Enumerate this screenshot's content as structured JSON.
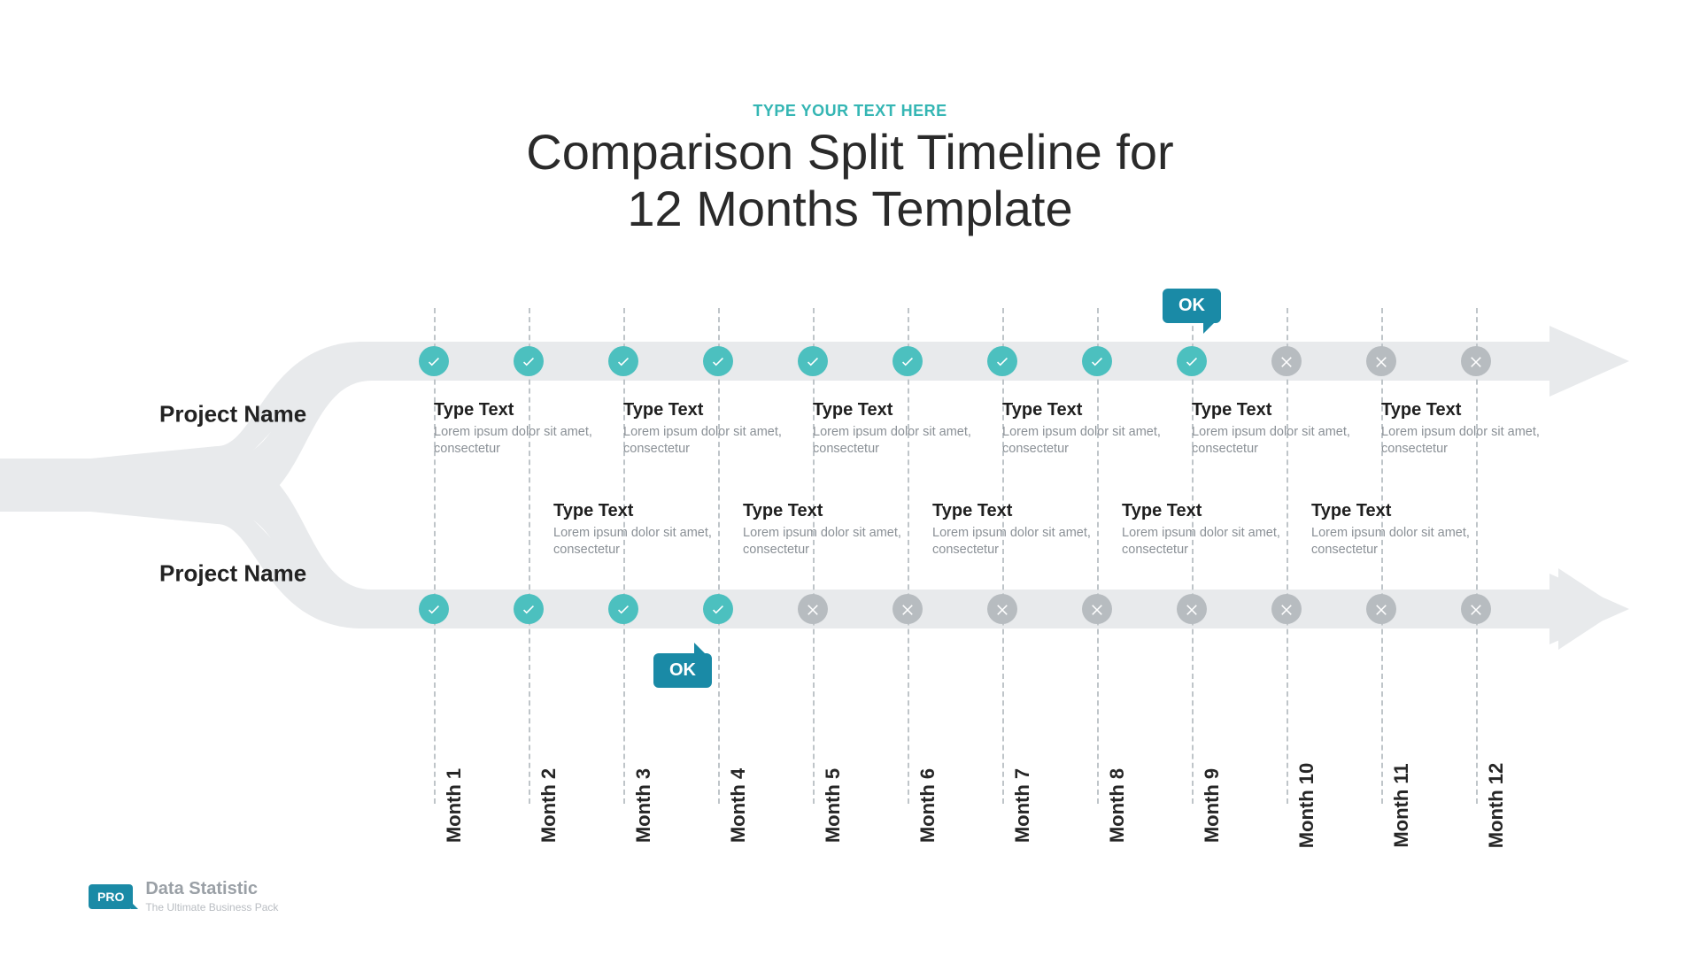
{
  "header": {
    "eyebrow": "TYPE YOUR TEXT HERE",
    "title_line1": "Comparison Split Timeline for",
    "title_line2": "12 Months Template"
  },
  "brand": {
    "badge": "PRO",
    "name": "Data Statistic",
    "tag": "The Ultimate Business Pack"
  },
  "bubble_label": "OK",
  "project_top": {
    "name": "Project Name"
  },
  "project_bottom": {
    "name": "Project Name"
  },
  "months": [
    "Month 1",
    "Month 2",
    "Month 3",
    "Month 4",
    "Month 5",
    "Month 6",
    "Month 7",
    "Month 8",
    "Month 9",
    "Month 10",
    "Month 11",
    "Month 12"
  ],
  "top_status": [
    "ok",
    "ok",
    "ok",
    "ok",
    "ok",
    "ok",
    "ok",
    "ok",
    "ok",
    "x",
    "x",
    "x"
  ],
  "bottom_status": [
    "ok",
    "ok",
    "ok",
    "ok",
    "x",
    "x",
    "x",
    "x",
    "x",
    "x",
    "x",
    "x"
  ],
  "bubble_top_index": 8,
  "bubble_bottom_index": 3,
  "top_blocks": [
    {
      "title": "Type Text",
      "body": "Lorem ipsum dolor sit amet, consectetur"
    },
    {
      "title": "Type Text",
      "body": "Lorem ipsum dolor sit amet, consectetur"
    },
    {
      "title": "Type Text",
      "body": "Lorem ipsum dolor sit amet, consectetur"
    },
    {
      "title": "Type Text",
      "body": "Lorem ipsum dolor sit amet, consectetur"
    },
    {
      "title": "Type Text",
      "body": "Lorem ipsum dolor sit amet, consectetur"
    },
    {
      "title": "Type Text",
      "body": "Lorem ipsum dolor sit amet, consectetur"
    }
  ],
  "bottom_blocks": [
    {
      "title": "Type Text",
      "body": "Lorem ipsum dolor sit amet, consectetur"
    },
    {
      "title": "Type Text",
      "body": "Lorem ipsum dolor sit amet, consectetur"
    },
    {
      "title": "Type Text",
      "body": "Lorem ipsum dolor sit amet, consectetur"
    },
    {
      "title": "Type Text",
      "body": "Lorem ipsum dolor sit amet, consectetur"
    },
    {
      "title": "Type Text",
      "body": "Lorem ipsum dolor sit amet, consectetur"
    }
  ],
  "chart_data": {
    "type": "table",
    "title": "Comparison Split Timeline for 12 Months Template",
    "categories": [
      "Month 1",
      "Month 2",
      "Month 3",
      "Month 4",
      "Month 5",
      "Month 6",
      "Month 7",
      "Month 8",
      "Month 9",
      "Month 10",
      "Month 11",
      "Month 12"
    ],
    "series": [
      {
        "name": "Project Name (top)",
        "values": [
          1,
          1,
          1,
          1,
          1,
          1,
          1,
          1,
          1,
          0,
          0,
          0
        ]
      },
      {
        "name": "Project Name (bottom)",
        "values": [
          1,
          1,
          1,
          1,
          0,
          0,
          0,
          0,
          0,
          0,
          0,
          0
        ]
      }
    ],
    "legend": {
      "1": "check / complete",
      "0": "x / not complete"
    },
    "callouts": [
      {
        "series": 0,
        "index": 8,
        "label": "OK"
      },
      {
        "series": 1,
        "index": 3,
        "label": "OK"
      }
    ]
  }
}
